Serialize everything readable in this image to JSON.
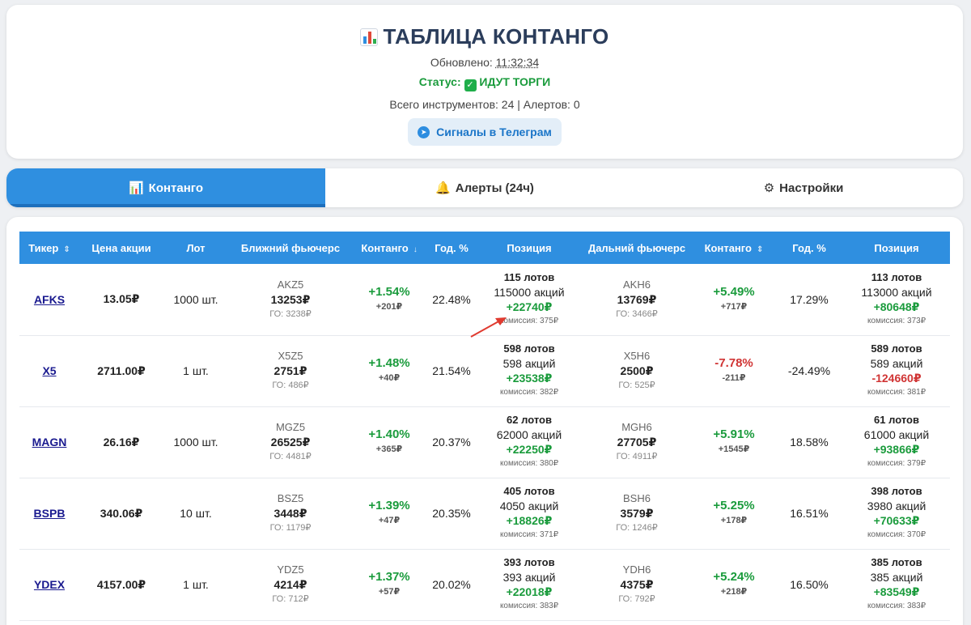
{
  "header": {
    "title": "ТАБЛИЦА КОНТАНГО",
    "updated_label": "Обновлено:",
    "updated_time": "11:32:34",
    "status_label": "Статус:",
    "status_value": "ИДУТ ТОРГИ",
    "totals": "Всего инструментов: 24 | Алертов: 0",
    "telegram_button": "Сигналы в Телеграм"
  },
  "tabs": [
    {
      "label": "Контанго",
      "icon": "chart-icon",
      "active": true
    },
    {
      "label": "Алерты (24ч)",
      "icon": "bell-icon",
      "active": false
    },
    {
      "label": "Настройки",
      "icon": "gear-icon",
      "active": false
    }
  ],
  "table": {
    "columns": [
      "Тикер",
      "Цена акции",
      "Лот",
      "Ближний фьючерс",
      "Контанго",
      "Год. %",
      "Позиция",
      "Дальний фьючерс",
      "Контанго",
      "Год. %",
      "Позиция"
    ],
    "rows": [
      {
        "ticker": "AFKS",
        "price": "13.05₽",
        "lot": "1000 шт.",
        "near": {
          "code": "AKZ5",
          "price": "13253₽",
          "go": "ГО: 3238₽",
          "contango_pct": "+1.54%",
          "contango_abs": "+201₽",
          "annual": "22.48%",
          "lots": "115 лотов",
          "shares": "115000 акций",
          "profit": "+22740₽",
          "commission": "комиссия: 375₽"
        },
        "far": {
          "code": "AKH6",
          "price": "13769₽",
          "go": "ГО: 3466₽",
          "contango_pct": "+5.49%",
          "contango_abs": "+717₽",
          "annual": "17.29%",
          "lots": "113 лотов",
          "shares": "113000 акций",
          "profit": "+80648₽",
          "commission": "комиссия: 373₽"
        }
      },
      {
        "ticker": "X5",
        "price": "2711.00₽",
        "lot": "1 шт.",
        "near": {
          "code": "X5Z5",
          "price": "2751₽",
          "go": "ГО: 486₽",
          "contango_pct": "+1.48%",
          "contango_abs": "+40₽",
          "annual": "21.54%",
          "lots": "598 лотов",
          "shares": "598 акций",
          "profit": "+23538₽",
          "commission": "комиссия: 382₽"
        },
        "far": {
          "code": "X5H6",
          "price": "2500₽",
          "go": "ГО: 525₽",
          "contango_pct": "-7.78%",
          "contango_abs": "-211₽",
          "annual": "-24.49%",
          "lots": "589 лотов",
          "shares": "589 акций",
          "profit": "-124660₽",
          "commission": "комиссия: 381₽"
        }
      },
      {
        "ticker": "MAGN",
        "price": "26.16₽",
        "lot": "1000 шт.",
        "near": {
          "code": "MGZ5",
          "price": "26525₽",
          "go": "ГО: 4481₽",
          "contango_pct": "+1.40%",
          "contango_abs": "+365₽",
          "annual": "20.37%",
          "lots": "62 лотов",
          "shares": "62000 акций",
          "profit": "+22250₽",
          "commission": "комиссия: 380₽"
        },
        "far": {
          "code": "MGH6",
          "price": "27705₽",
          "go": "ГО: 4911₽",
          "contango_pct": "+5.91%",
          "contango_abs": "+1545₽",
          "annual": "18.58%",
          "lots": "61 лотов",
          "shares": "61000 акций",
          "profit": "+93866₽",
          "commission": "комиссия: 379₽"
        }
      },
      {
        "ticker": "BSPB",
        "price": "340.06₽",
        "lot": "10 шт.",
        "near": {
          "code": "BSZ5",
          "price": "3448₽",
          "go": "ГО: 1179₽",
          "contango_pct": "+1.39%",
          "contango_abs": "+47₽",
          "annual": "20.35%",
          "lots": "405 лотов",
          "shares": "4050 акций",
          "profit": "+18826₽",
          "commission": "комиссия: 371₽"
        },
        "far": {
          "code": "BSH6",
          "price": "3579₽",
          "go": "ГО: 1246₽",
          "contango_pct": "+5.25%",
          "contango_abs": "+178₽",
          "annual": "16.51%",
          "lots": "398 лотов",
          "shares": "3980 акций",
          "profit": "+70633₽",
          "commission": "комиссия: 370₽"
        }
      },
      {
        "ticker": "YDEX",
        "price": "4157.00₽",
        "lot": "1 шт.",
        "near": {
          "code": "YDZ5",
          "price": "4214₽",
          "go": "ГО: 712₽",
          "contango_pct": "+1.37%",
          "contango_abs": "+57₽",
          "annual": "20.02%",
          "lots": "393 лотов",
          "shares": "393 акций",
          "profit": "+22018₽",
          "commission": "комиссия: 383₽"
        },
        "far": {
          "code": "YDH6",
          "price": "4375₽",
          "go": "ГО: 792₽",
          "contango_pct": "+5.24%",
          "contango_abs": "+218₽",
          "annual": "16.50%",
          "lots": "385 лотов",
          "shares": "385 акций",
          "profit": "+83549₽",
          "commission": "комиссия: 383₽"
        }
      }
    ]
  },
  "colors": {
    "accent": "#2f8fe0",
    "positive": "#1a9b3c",
    "negative": "#d03434",
    "annotation_arrow": "#e03a2f"
  }
}
